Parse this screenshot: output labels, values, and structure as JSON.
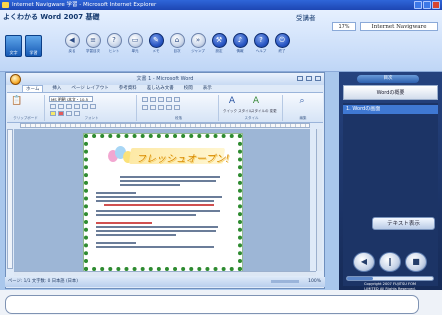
{
  "window": {
    "title": "Internet Navigware 学習 - Microsoft Internet Explorer"
  },
  "header": {
    "course_title": "よくわかる Word 2007 基礎",
    "student_label": "受講者",
    "zoom": "17%",
    "brand": "Internet Navigware"
  },
  "mode_buttons": [
    {
      "label": "文字"
    },
    {
      "label": "学習"
    }
  ],
  "toolbar": [
    {
      "label": "戻る",
      "icon": "◀"
    },
    {
      "label": "学習目次",
      "icon": "≡"
    },
    {
      "label": "ヒント",
      "icon": "?"
    },
    {
      "label": "単元",
      "icon": "▭"
    },
    {
      "label": "メモ",
      "icon": "✎"
    },
    {
      "label": "目次",
      "icon": "⌂"
    },
    {
      "label": "ジャンプ",
      "icon": "»"
    },
    {
      "label": "設定",
      "icon": "⚒"
    },
    {
      "label": "情報",
      "icon": "♪"
    },
    {
      "label": "ヘルプ",
      "icon": "?"
    },
    {
      "label": "終了",
      "icon": "⏻"
    }
  ],
  "word": {
    "title": "文書 1 - Microsoft Word",
    "tabs": [
      "ホーム",
      "挿入",
      "ページ レイアウト",
      "参考資料",
      "差し込み文書",
      "校閲",
      "表示"
    ],
    "font_name": "MS 明朝 (本文・10.5",
    "groups": [
      "クリップボード",
      "フォント",
      "段落",
      "スタイル",
      "編集"
    ],
    "style_labels": [
      "クイック スタイル",
      "スタイルの 変更"
    ],
    "headline": "フレッシュオープン!",
    "status": "ページ: 1/1   文字数: 0   日本語 (日本)",
    "zoom": "100%"
  },
  "side": {
    "button": "目次",
    "panel_title": "Wordの概要",
    "list_item": "1. Wordの画面",
    "text_hide_button": "テキスト表示"
  },
  "player": {
    "buttons": [
      "◀",
      "‖",
      "■"
    ],
    "progress": 0.3
  },
  "copyright": {
    "line1": "Copyright 2007 FUJITSU FOM",
    "line2": "LIMITED All Rights Reserved."
  },
  "colors": {
    "accent": "#1d46b3",
    "side_bg": "#162b58",
    "page_border": "#2e8b30"
  }
}
